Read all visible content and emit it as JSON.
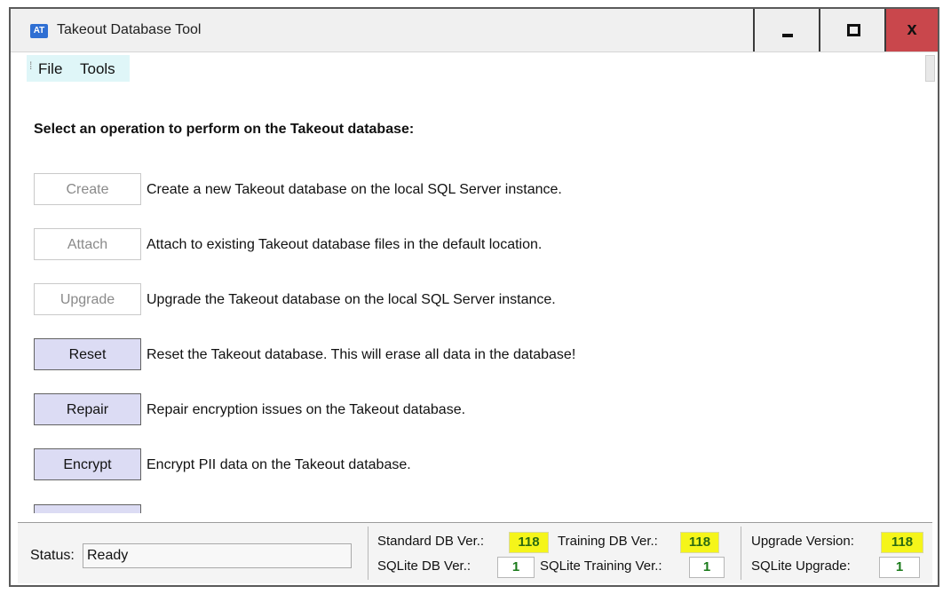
{
  "window": {
    "app_icon_text": "AT",
    "title": "Takeout Database Tool",
    "close_glyph": "x"
  },
  "menu": {
    "items": [
      {
        "label": "File"
      },
      {
        "label": "Tools"
      }
    ]
  },
  "main": {
    "heading": "Select an operation to perform on the Takeout database:",
    "operations": [
      {
        "label": "Create",
        "enabled": false,
        "description": "Create a new Takeout database on the local SQL Server instance."
      },
      {
        "label": "Attach",
        "enabled": false,
        "description": "Attach to existing Takeout database files in the default location."
      },
      {
        "label": "Upgrade",
        "enabled": false,
        "description": "Upgrade the Takeout database on the local SQL Server instance."
      },
      {
        "label": "Reset",
        "enabled": true,
        "description": "Reset the Takeout database. This will erase all data in the database!"
      },
      {
        "label": "Repair",
        "enabled": true,
        "description": "Repair encryption issues on the Takeout database."
      },
      {
        "label": "Encrypt",
        "enabled": true,
        "description": "Encrypt PII data on the Takeout database."
      }
    ]
  },
  "status": {
    "label": "Status:",
    "value": "Ready"
  },
  "versions": {
    "standard_label": "Standard DB Ver.:",
    "standard_value": "118",
    "training_label": "Training DB Ver.:",
    "training_value": "118",
    "sqlite_label": "SQLite DB Ver.:",
    "sqlite_value": "1",
    "sqlite_training_label": "SQLite Training Ver.:",
    "sqlite_training_value": "1",
    "upgrade_label": "Upgrade Version:",
    "upgrade_value": "118",
    "sqlite_upgrade_label": "SQLite Upgrade:",
    "sqlite_upgrade_value": "1"
  },
  "colors": {
    "highlight": "#f5f51a",
    "enabled_button": "#dcdcf4",
    "close_button": "#c9474c",
    "menubar": "#dff6f8"
  }
}
